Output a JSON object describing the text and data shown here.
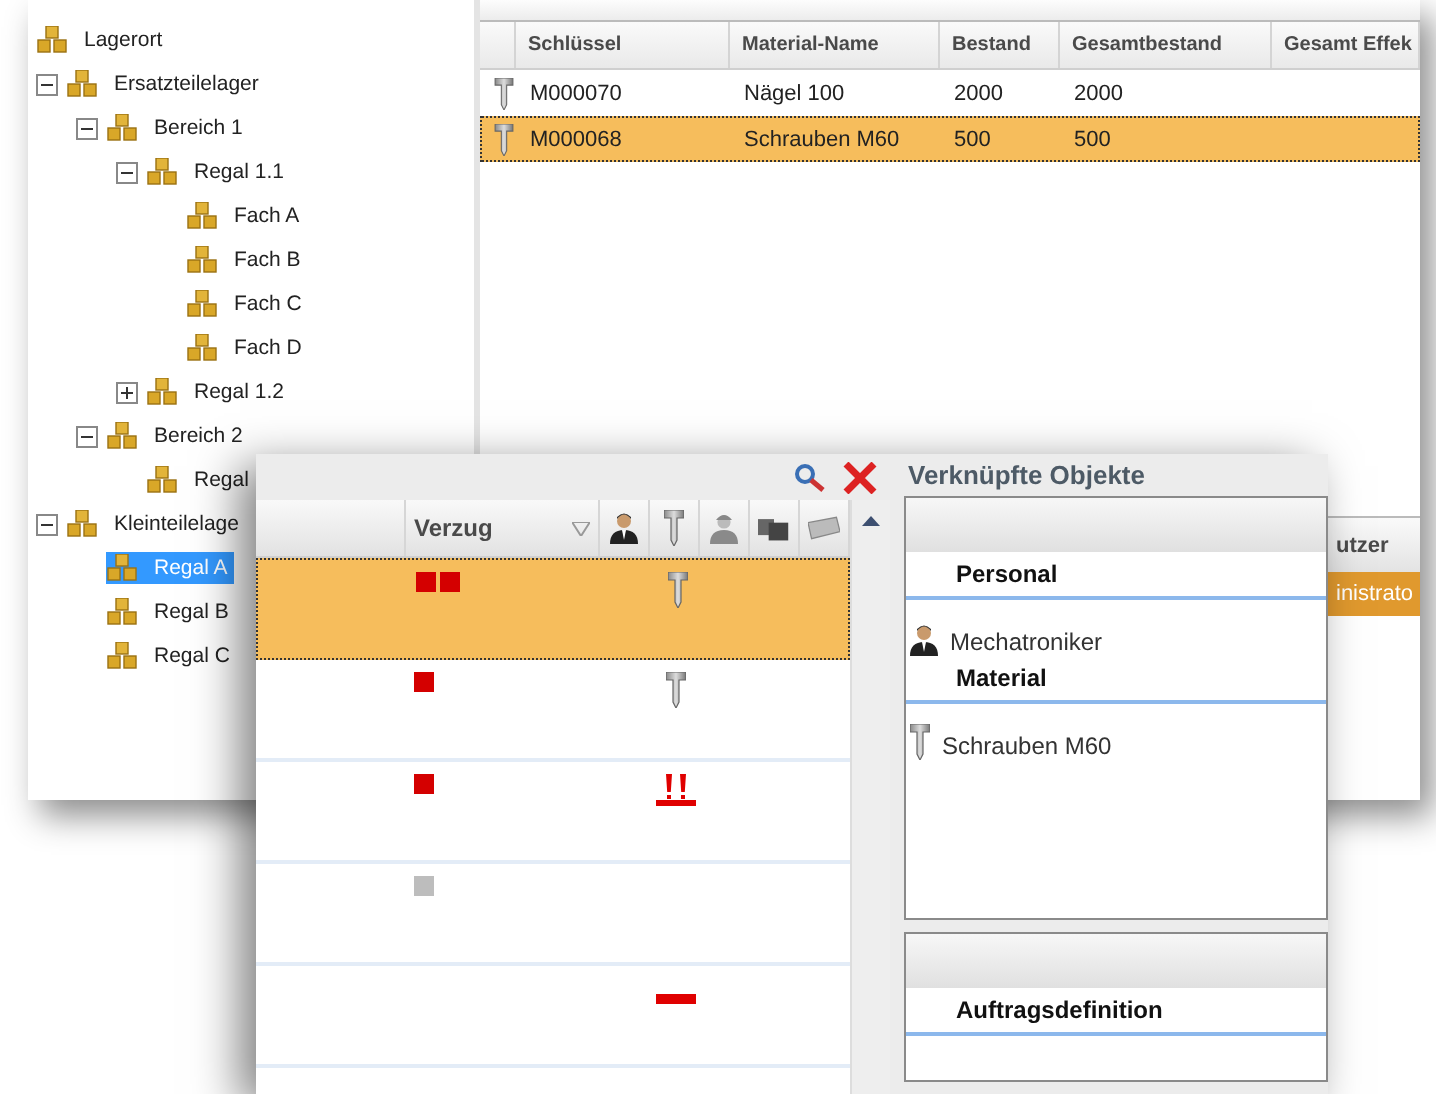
{
  "location_tree": {
    "items": [
      {
        "label": "Lagerort",
        "selected": false,
        "children": [
          {
            "label": "Ersatzteilelager",
            "expanded": true,
            "selected": false,
            "children": [
              {
                "label": "Bereich 1",
                "expanded": true,
                "selected": false,
                "children": [
                  {
                    "label": "Regal 1.1",
                    "expanded": true,
                    "selected": false,
                    "children": [
                      {
                        "label": "Fach A",
                        "selected": false
                      },
                      {
                        "label": "Fach B",
                        "selected": false
                      },
                      {
                        "label": "Fach C",
                        "selected": false
                      },
                      {
                        "label": "Fach D",
                        "selected": false
                      }
                    ]
                  },
                  {
                    "label": "Regal 1.2",
                    "expanded": false,
                    "selected": false
                  }
                ]
              },
              {
                "label": "Bereich 2",
                "expanded": true,
                "selected": false,
                "children": [
                  {
                    "label": "Regal",
                    "selected": false
                  }
                ]
              }
            ]
          },
          {
            "label": "Kleinteilelage",
            "expanded": true,
            "selected": false,
            "children": [
              {
                "label": "Regal A",
                "selected": true
              },
              {
                "label": "Regal B",
                "selected": false
              },
              {
                "label": "Regal C",
                "selected": false
              }
            ]
          }
        ]
      }
    ]
  },
  "material_table": {
    "columns": [
      "Schlüssel",
      "Material-Name",
      "Bestand",
      "Gesamtbestand",
      "Gesamt Effek"
    ],
    "rows": [
      {
        "selected": false,
        "cells": [
          "M000070",
          "Nägel 100",
          "2000",
          "2000"
        ]
      },
      {
        "selected": true,
        "cells": [
          "M000068",
          "Schrauben M60",
          "500",
          "500"
        ]
      }
    ]
  },
  "user_table": {
    "column": "utzer",
    "rows": [
      {
        "cell": "inistrato",
        "selected": true
      }
    ]
  },
  "order_grid": {
    "columns": [
      {
        "kind": "blank"
      },
      {
        "kind": "text",
        "label": "Verzug"
      },
      {
        "kind": "person"
      },
      {
        "kind": "screw"
      },
      {
        "kind": "worker"
      },
      {
        "kind": "boxes"
      },
      {
        "kind": "tag"
      }
    ],
    "rows": [
      {
        "selected": true,
        "delay_squares": [
          {
            "color": "#d40000"
          },
          {
            "color": "#d40000"
          }
        ],
        "material_icon": {
          "kind": "screw"
        }
      },
      {
        "selected": false,
        "delay_squares": [
          {
            "color": "#d40000"
          }
        ],
        "material_icon": {
          "kind": "screw"
        }
      },
      {
        "selected": false,
        "delay_squares": [
          {
            "color": "#d40000"
          }
        ],
        "material_icon": {
          "kind": "alert"
        }
      },
      {
        "selected": false,
        "delay_squares": [
          {
            "color": "#bdbdbd"
          }
        ]
      },
      {
        "selected": false,
        "material_icon": {
          "kind": "minus"
        }
      }
    ]
  },
  "linked_objects": {
    "title": "Verknüpfte Objekte",
    "sections": [
      {
        "title": "Personal",
        "items": [
          {
            "kind": "person",
            "label": "Mechatroniker"
          }
        ]
      },
      {
        "title": "Material",
        "items": [
          {
            "kind": "screw",
            "label": "Schrauben M60"
          }
        ]
      }
    ],
    "second_box": {
      "sections": [
        {
          "title": "Auftragsdefinition"
        }
      ]
    }
  }
}
